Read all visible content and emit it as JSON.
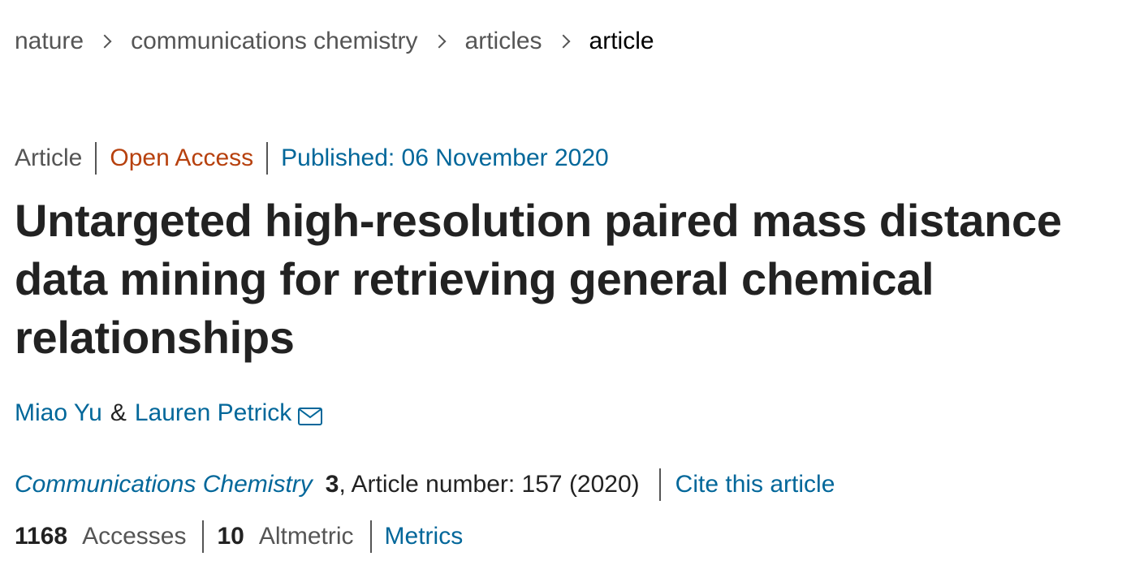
{
  "breadcrumb": {
    "items": [
      "nature",
      "communications chemistry",
      "articles"
    ],
    "current": "article"
  },
  "meta": {
    "type": "Article",
    "access": "Open Access",
    "published": "Published: 06 November 2020"
  },
  "title": "Untargeted high-resolution paired mass distance data mining for retrieving general chemical relationships",
  "authors": {
    "first": "Miao Yu",
    "separator": "&",
    "second": "Lauren Petrick",
    "contact_icon": "envelope-icon"
  },
  "citation": {
    "journal": "Communications Chemistry",
    "volume": "3",
    "details": ", Article number: 157 (2020)",
    "cite_label": "Cite this article"
  },
  "metrics": {
    "accesses_count": "1168",
    "accesses_label": "Accesses",
    "altmetric_count": "10",
    "altmetric_label": "Altmetric",
    "metrics_link": "Metrics"
  },
  "colors": {
    "link": "#02679a",
    "open_access": "#b7410e",
    "text": "#222222",
    "muted": "#555555"
  }
}
